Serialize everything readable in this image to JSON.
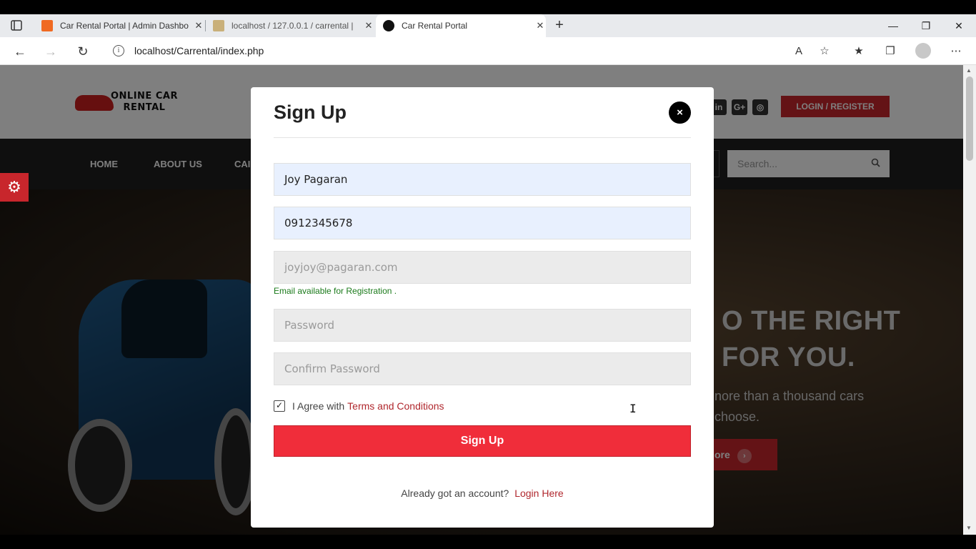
{
  "browser": {
    "tabs": [
      {
        "title": "Car Rental Portal | Admin Dashbo",
        "close": "✕"
      },
      {
        "title": "localhost / 127.0.0.1 / carrental |",
        "close": "✕"
      },
      {
        "title": "Car Rental Portal",
        "close": "✕"
      }
    ],
    "new_tab": "+",
    "url": "localhost/Carrental/index.php",
    "window_controls": {
      "minimize": "—",
      "restore": "❐",
      "close": "✕"
    }
  },
  "site": {
    "logo_text_line1": "ONLINE CAR",
    "logo_text_line2": "RENTAL",
    "social_icons": [
      "in",
      "G+",
      "◎"
    ],
    "login_button": "LOGIN / REGISTER",
    "nav": [
      "HOME",
      "ABOUT US",
      "CAI"
    ],
    "search_placeholder": "Search...",
    "hero_heading_line1": "O THE RIGHT",
    "hero_heading_line2": "FOR YOU.",
    "hero_sub_line1": "nore than a thousand cars",
    "hero_sub_line2": "choose.",
    "hero_button": "ore"
  },
  "modal": {
    "title": "Sign Up",
    "close": "×",
    "full_name": "Joy Pagaran",
    "mobile": "0912345678",
    "email_placeholder": "joyjoy@pagaran.com",
    "email_status": "Email available for Registration .",
    "password_placeholder": "Password",
    "confirm_placeholder": "Confirm Password",
    "agree_text": "I Agree with",
    "terms_link": "Terms and Conditions",
    "agree_checked": true,
    "submit": "Sign Up",
    "already_text": "Already got an account?",
    "login_link": "Login Here"
  },
  "colors": {
    "brand_red": "#c8262c",
    "signup_button": "#f02d3a",
    "success_green": "#1a7a1a"
  }
}
